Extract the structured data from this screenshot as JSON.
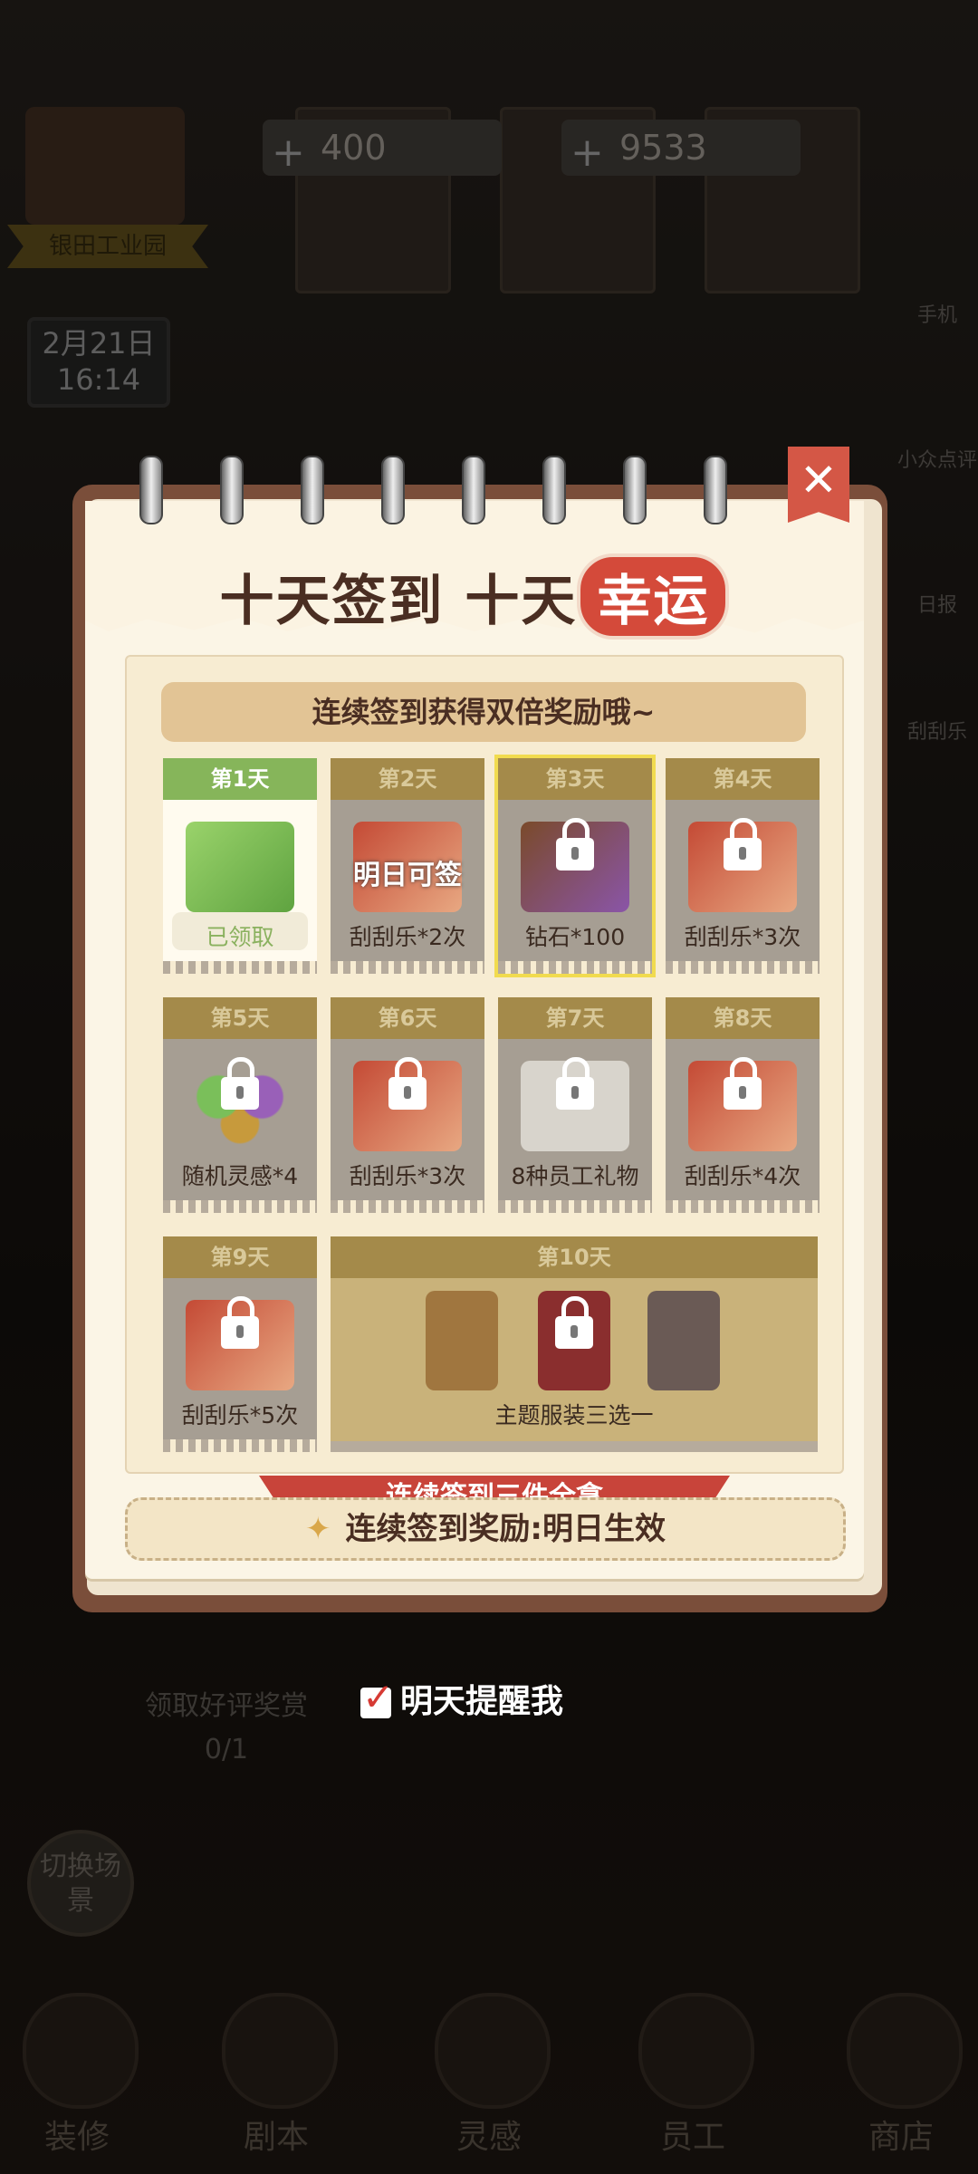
{
  "background": {
    "resources": [
      {
        "name": "diamond",
        "value": "400"
      },
      {
        "name": "cash",
        "value": "9533"
      }
    ],
    "shop_name": "银田工业园",
    "date": "2月21日",
    "time": "16:14",
    "side_menu": [
      "手机",
      "小众点评",
      "日报",
      "刮刮乐"
    ],
    "review_title": "领取好评奖赏",
    "review_count": "0/1",
    "switch_scene": "切换场景",
    "nav": [
      "装修",
      "剧本",
      "灵感",
      "员工",
      "商店"
    ]
  },
  "modal": {
    "title_prefix": "十天签到 十天",
    "title_lucky": "幸运",
    "subtitle": "连续签到获得双倍奖励哦~",
    "days": [
      {
        "tag": "第1天",
        "label": "已领取",
        "state": "claimed",
        "icon": "cash-stack-icon"
      },
      {
        "tag": "第2天",
        "label": "刮刮乐*2次",
        "state": "tomorrow",
        "overlay": "明日可签",
        "icon": "scratch-ticket-icon"
      },
      {
        "tag": "第3天",
        "label": "钻石*100",
        "state": "locked",
        "icon": "diamond-chest-icon"
      },
      {
        "tag": "第4天",
        "label": "刮刮乐*3次",
        "state": "locked",
        "icon": "scratch-ticket-icon"
      },
      {
        "tag": "第5天",
        "label": "随机灵感*4",
        "state": "locked",
        "icon": "inspiration-orbs-icon"
      },
      {
        "tag": "第6天",
        "label": "刮刮乐*3次",
        "state": "locked",
        "icon": "scratch-ticket-icon"
      },
      {
        "tag": "第7天",
        "label": "8种员工礼物",
        "state": "locked",
        "icon": "gift-icon"
      },
      {
        "tag": "第8天",
        "label": "刮刮乐*4次",
        "state": "locked",
        "icon": "scratch-ticket-icon"
      },
      {
        "tag": "第9天",
        "label": "刮刮乐*5次",
        "state": "locked",
        "icon": "scratch-ticket-icon"
      }
    ],
    "day10": {
      "tag": "第10天",
      "label": "主题服装三选一",
      "ribbon": "连续签到三件全拿"
    },
    "bonus": "连续签到奖励:明日生效",
    "remind": "明天提醒我",
    "colors": {
      "accent": "#d44a3a",
      "claimed": "#86b55a",
      "today_border": "#f1db4f"
    }
  }
}
